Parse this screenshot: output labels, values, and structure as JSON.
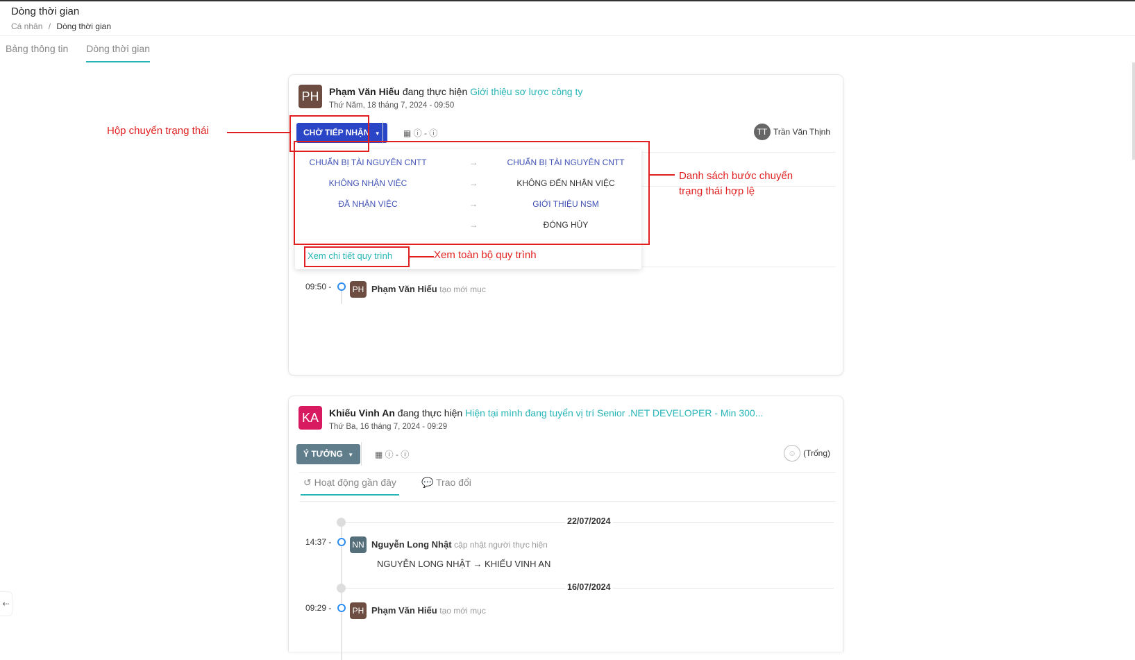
{
  "header": {
    "title": "Dòng thời gian",
    "breadcrumb_root": "Cá nhân",
    "breadcrumb_sep": "/",
    "breadcrumb_current": "Dòng thời gian"
  },
  "tabs": [
    {
      "label": "Bảng thông tin"
    },
    {
      "label": "Dòng thời gian"
    }
  ],
  "cards": [
    {
      "avatar": "PH",
      "avatar_color": "#6d4c41",
      "actor": "Phạm Văn Hiếu",
      "verb": "đang thực hiện",
      "task": "Giới thiệu sơ lược công ty",
      "date": "Thứ Năm, 18 tháng 7, 2024 - 09:50",
      "status_label": "CHỜ TIẾP NHẬN",
      "status_color": "#2a45c5",
      "meta": "▦ ⓘ - ⓘ",
      "assignee_initials": "TT",
      "assignee_name": "Trần Văn Thịnh",
      "timeline": [
        {
          "time": "09:50 -",
          "avatar": "PH",
          "actor": "Phạm Văn Hiếu",
          "action": "tạo mới mục"
        }
      ]
    },
    {
      "avatar": "KA",
      "avatar_color": "#d81b60",
      "actor": "Khiếu Vinh An",
      "verb": "đang thực hiện",
      "task": "Hiện tại mình đang tuyển vị trí Senior .NET DEVELOPER - Min 300...",
      "date": "Thứ Ba, 16 tháng 7, 2024 - 09:29",
      "status_label": "Ý TƯỞNG",
      "status_color": "#607d8b",
      "meta": "▦ ⓘ - ⓘ",
      "assignee_name": "(Trống)",
      "subtabs": [
        {
          "label": "↺ Hoạt động gần đây"
        },
        {
          "label": "💬 Trao đổi"
        }
      ],
      "timeline": [
        {
          "date": "22/07/2024"
        },
        {
          "time": "14:37 -",
          "avatar": "NN",
          "avatar_color": "#546e7a",
          "actor": "Nguyễn Long Nhật",
          "action": "cập nhật người thực hiện",
          "change": "NGUYỄN LONG NHẬT → KHIẾU VINH AN"
        },
        {
          "date": "16/07/2024"
        },
        {
          "time": "09:29 -",
          "avatar": "PH",
          "avatar_color": "#6d4c41",
          "actor": "Phạm Văn Hiếu",
          "action": "tạo mới mục"
        }
      ]
    }
  ],
  "dropdown": {
    "transitions": [
      {
        "from": "CHUẨN BỊ TÀI NGUYÊN CNTT",
        "arrow": "→",
        "to": "CHUẨN BỊ TÀI NGUYÊN CNTT"
      },
      {
        "from": "KHÔNG NHẬN VIỆC",
        "arrow": "→",
        "to": "KHÔNG ĐẾN NHẬN VIỆC"
      },
      {
        "from": "ĐÃ NHẬN VIỆC",
        "arrow": "→",
        "to": "GIỚI THIỆU NSM"
      },
      {
        "from": "",
        "arrow": "→",
        "to": "ĐÓNG HỦY"
      }
    ],
    "detail_link": "Xem chi tiết quy trình"
  },
  "annotations": {
    "status_box": "Hộp chuyển trạng thái",
    "transition_list_line1": "Danh sách bước chuyển",
    "transition_list_line2": "trạng thái hợp lệ",
    "process_view": "Xem toàn bộ quy trình"
  }
}
